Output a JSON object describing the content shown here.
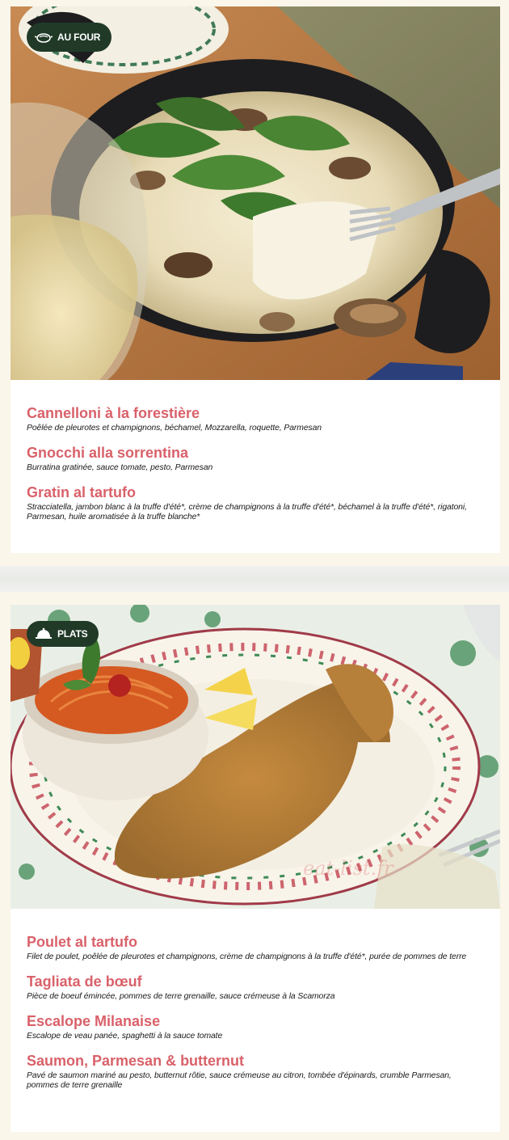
{
  "sections": [
    {
      "badge": "AU FOUR",
      "badge_icon": "oven-dish-icon",
      "items": [
        {
          "title": "Cannelloni à la forestière",
          "desc": "Poêlée de pleurotes et champignons, béchamel, Mozzarella, roquette, Parmesan"
        },
        {
          "title": "Gnocchi alla sorrentina",
          "desc": "Burratina gratinée, sauce tomate, pesto, Parmesan"
        },
        {
          "title": "Gratin al tartufo",
          "desc": "Stracciatella, jambon blanc à la truffe d'été*, crème de champignons à la truffe d'été*, béchamel à la truffe d'été*, rigatoni, Parmesan, huile aromatisée à la truffe blanche*"
        }
      ]
    },
    {
      "badge": "PLATS",
      "badge_icon": "cloche-icon",
      "items": [
        {
          "title": "Poulet al tartufo",
          "desc": "Filet de poulet, poêlée de pleurotes et champignons, crème de champignons à la truffe d'été*, purée de pommes de terre"
        },
        {
          "title": "Tagliata de bœuf",
          "desc": "Pièce de boeuf émincée, pommes de terre grenaille, sauce crémeuse à la Scamorza"
        },
        {
          "title": "Escalope Milanaise",
          "desc": "Escalope de veau panée, spaghetti à la sauce tomate"
        },
        {
          "title": "Saumon, Parmesan & butternut",
          "desc": "Pavé de saumon mariné au pesto, butternut rôtie, sauce crémeuse au citron, tombée d'épinards, crumble Parmesan, pommes de terre grenaille"
        }
      ]
    }
  ],
  "watermark": "eat-list.fr",
  "colors": {
    "badge_bg": "#213a28",
    "title_red": "#d9616a",
    "page_bg": "#fbf6ea"
  }
}
